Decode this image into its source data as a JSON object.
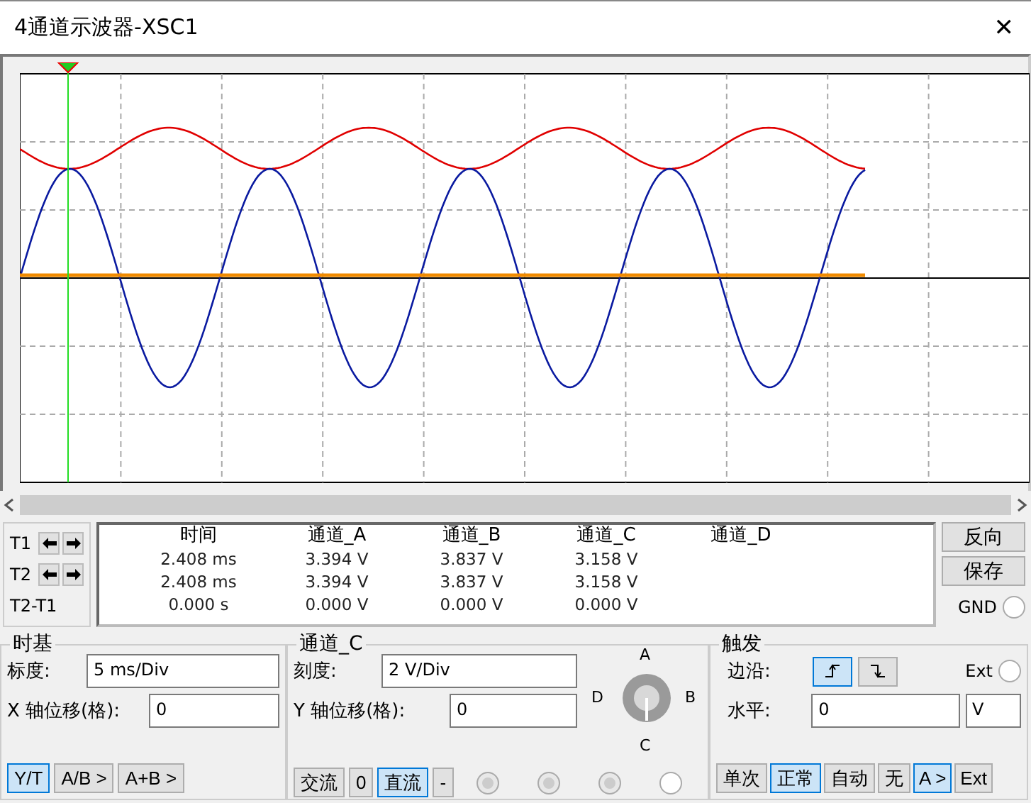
{
  "window": {
    "title": "4通道示波器-XSC1",
    "close": "✕"
  },
  "cursors": [
    {
      "label": "T1",
      "movable": true
    },
    {
      "label": "T2",
      "movable": true
    },
    {
      "label": "T2-T1",
      "movable": false
    }
  ],
  "readout": {
    "columns": [
      "时间",
      "通道_A",
      "通道_B",
      "通道_C",
      "通道_D"
    ],
    "rows": [
      [
        "2.408 ms",
        "3.394 V",
        "3.837 V",
        "3.158 V"
      ],
      [
        "2.408 ms",
        "3.394 V",
        "3.837 V",
        "3.158 V"
      ],
      [
        "0.000 s",
        "0.000 V",
        "0.000 V",
        "0.000 V"
      ]
    ]
  },
  "side_buttons": [
    "反向",
    "保存"
  ],
  "gnd": {
    "label": "GND",
    "selected": false
  },
  "timebase": {
    "title": "时基",
    "scale_label": "标度:",
    "scale": "5 ms/Div",
    "xpos_label": "X 轴位移(格):",
    "xpos": "0",
    "modes": [
      {
        "label": "Y/T",
        "selected": true
      },
      {
        "label": "A/B >",
        "selected": false
      },
      {
        "label": "A+B >",
        "selected": false
      }
    ]
  },
  "channel": {
    "title": "通道_C",
    "scale_label": "刻度:",
    "scale": "2  V/Div",
    "ypos_label": "Y 轴位移(格):",
    "ypos": "0",
    "knob": {
      "top": "A",
      "right": "B",
      "bottom": "C",
      "left": "D"
    },
    "coupling": [
      {
        "label": "交流",
        "selected": false
      },
      {
        "label": "0",
        "selected": false
      },
      {
        "label": "直流",
        "selected": true
      },
      {
        "label": "-",
        "selected": false
      }
    ],
    "radios": [
      {
        "disabled": true
      },
      {
        "disabled": true
      },
      {
        "disabled": true
      },
      {
        "disabled": false
      }
    ]
  },
  "trigger": {
    "title": "触发",
    "edge_label": "边沿:",
    "edges": [
      {
        "kind": "rising",
        "selected": true
      },
      {
        "kind": "falling",
        "selected": false
      }
    ],
    "ext": {
      "label": "Ext",
      "selected": false
    },
    "level_label": "水平:",
    "level": "0",
    "unit": "V",
    "modes": [
      {
        "label": "单次",
        "selected": false
      },
      {
        "label": "正常",
        "selected": true
      },
      {
        "label": "自动",
        "selected": false
      },
      {
        "label": "无",
        "selected": false
      }
    ],
    "sources": [
      {
        "label": "A >",
        "selected": true
      },
      {
        "label": "Ext",
        "selected": false
      }
    ]
  }
}
